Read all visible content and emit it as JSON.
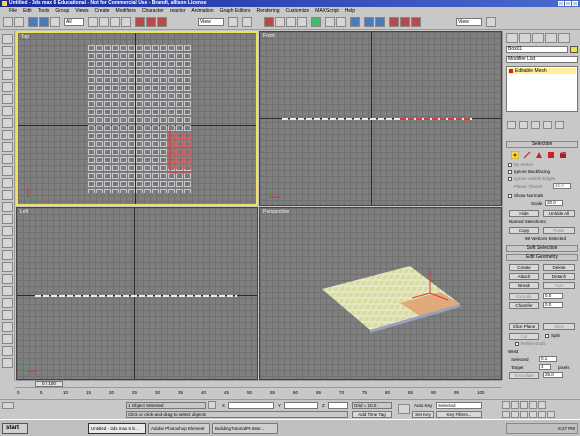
{
  "app": {
    "title": "Untitled - 3ds max 6 Educational - Not for Commercial Use - Brandt, allison License"
  },
  "menu": [
    "File",
    "Edit",
    "Tools",
    "Group",
    "Views",
    "Create",
    "Modifiers",
    "Character",
    "reactor",
    "Animation",
    "Graph Editors",
    "Rendering",
    "Customize",
    "MAXScript",
    "Help"
  ],
  "toolbar": {
    "ref_coord": "View",
    "named_sel": "View"
  },
  "viewports": {
    "top": "Top",
    "front": "Front",
    "left": "Left",
    "perspective": "Perspective"
  },
  "command_panel": {
    "object_name": "Box01",
    "modifier_list": "Modifier List",
    "stack_item": "Editable Mesh",
    "selection_rollout": "Selection",
    "by_vertex": "By Vertex",
    "ignore_backfacing": "Ignore Backfacing",
    "ignore_visible_edges": "Ignore Visible Edges",
    "planar_thresh_label": "Planar Thresh",
    "planar_thresh_value": "45.0",
    "show_normals": "Show Normals",
    "scale_label": "Scale",
    "scale_value": "20.0",
    "hide_btn": "Hide",
    "unhide_all_btn": "Unhide All",
    "named_selections": "Named Selections:",
    "copy_btn": "Copy",
    "paste_btn": "Paste",
    "selected_info": "98 Vertices Selected",
    "soft_selection": "Soft Selection",
    "edit_geometry": "Edit Geometry",
    "create_btn": "Create",
    "delete_btn": "Delete",
    "attach_btn": "Attach",
    "detach_btn": "Detach",
    "break_btn": "Break",
    "turn_btn": "Turn",
    "extrude_btn": "Extrude",
    "extrude_value": "0.0",
    "chamfer_btn": "Chamfer",
    "chamfer_value": "0.0",
    "slice_plane_btn": "Slice Plane",
    "slice_btn": "Slice",
    "cut_btn": "Cut",
    "split_label": "Split",
    "refine_ends": "Refine Ends",
    "weld_label": "Weld",
    "selected_weld": "Selected",
    "selected_weld_value": "0.1",
    "target_weld": "Target",
    "target_weld_value": "4",
    "pixels_label": "pixels",
    "tessellate_btn": "Tessellate",
    "tessellate_value": "25.0"
  },
  "timeline": {
    "slider": "0 / 100",
    "ticks": [
      "0",
      "5",
      "10",
      "15",
      "20",
      "25",
      "30",
      "35",
      "40",
      "45",
      "50",
      "55",
      "60",
      "65",
      "70",
      "75",
      "80",
      "85",
      "90",
      "95",
      "100"
    ]
  },
  "status": {
    "selection": "1 Object Selected",
    "prompt": "Click or click-and-drag to select objects",
    "x_label": "X",
    "y_label": "Y",
    "z_label": "Z",
    "grid": "Grid = 10.0",
    "add_time_tag": "Add Time Tag",
    "auto_key": "Auto Key",
    "auto_key_sel": "Selected",
    "set_key": "Set Key",
    "key_filters": "Key Filters..."
  },
  "taskbar": {
    "start": "start",
    "tasks": [
      "Untitled - 3ds max 6 E...",
      "Adobe Photoshop Element",
      "BuildingTutorialPt-Inter..."
    ],
    "time": "6:27 PM"
  },
  "colors": {
    "selection_frame": "#f0e060",
    "mesh_vertex": "#e8e8e8",
    "selected_vertex": "#d83a3a"
  }
}
